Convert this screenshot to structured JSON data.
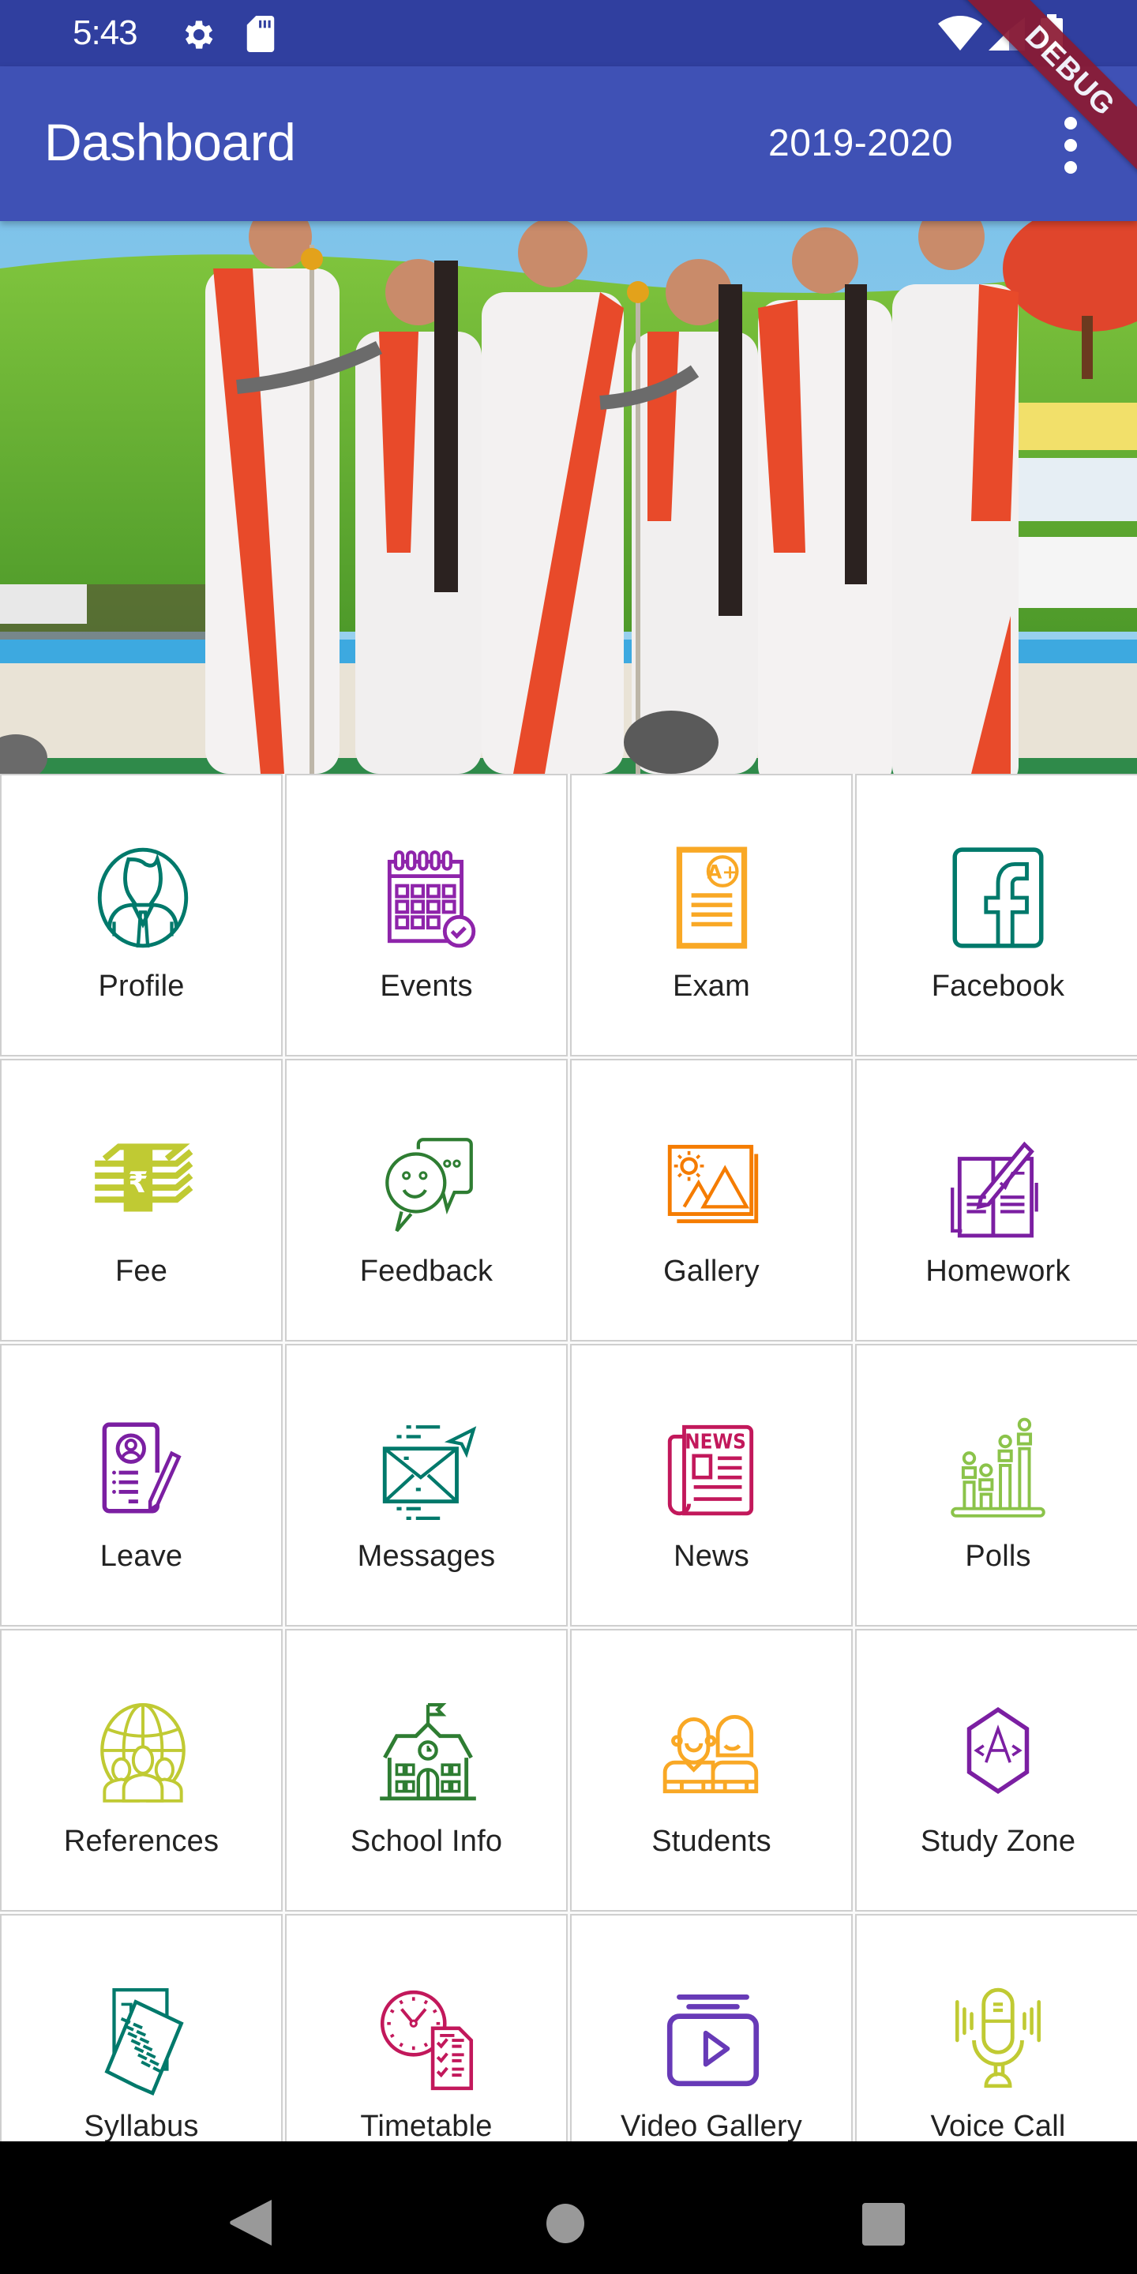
{
  "status_bar": {
    "time": "5:43",
    "left_icons": [
      "gear-icon",
      "sd-card-icon"
    ],
    "right_icons": [
      "wifi-icon",
      "signal-icon",
      "battery-icon"
    ]
  },
  "debug_banner": "DEBUG",
  "app_bar": {
    "title": "Dashboard",
    "session": "2019-2020",
    "menu_icon": "more-vert-icon"
  },
  "banner": {
    "description": "Students in white and red sarees singing at microphones on stage"
  },
  "tiles": [
    {
      "label": "Profile",
      "icon": "profile-icon",
      "color": "#00796b"
    },
    {
      "label": "Events",
      "icon": "calendar-icon",
      "color": "#8e24aa"
    },
    {
      "label": "Exam",
      "icon": "exam-sheet-icon",
      "color": "#f9a825"
    },
    {
      "label": "Facebook",
      "icon": "facebook-icon",
      "color": "#00796b"
    },
    {
      "label": "Fee",
      "icon": "rupee-stack-icon",
      "color": "#c0ca33"
    },
    {
      "label": "Feedback",
      "icon": "feedback-chat-icon",
      "color": "#2e7d32"
    },
    {
      "label": "Gallery",
      "icon": "gallery-icon",
      "color": "#f57c00"
    },
    {
      "label": "Homework",
      "icon": "homework-book-icon",
      "color": "#7b1fa2"
    },
    {
      "label": "Leave",
      "icon": "leave-form-icon",
      "color": "#7b1fa2"
    },
    {
      "label": "Messages",
      "icon": "envelope-send-icon",
      "color": "#00796b"
    },
    {
      "label": "News",
      "icon": "newspaper-icon",
      "color": "#c2185b"
    },
    {
      "label": "Polls",
      "icon": "poll-chart-icon",
      "color": "#8bc34a"
    },
    {
      "label": "References",
      "icon": "globe-people-icon",
      "color": "#c0ca33"
    },
    {
      "label": "School Info",
      "icon": "school-building-icon",
      "color": "#2e7d32"
    },
    {
      "label": "Students",
      "icon": "students-icon",
      "color": "#f9a825"
    },
    {
      "label": "Study Zone",
      "icon": "study-hexagon-icon",
      "color": "#7b1fa2"
    },
    {
      "label": "Syllabus",
      "icon": "syllabus-documents-icon",
      "color": "#00796b"
    },
    {
      "label": "Timetable",
      "icon": "timetable-clock-icon",
      "color": "#c2185b"
    },
    {
      "label": "Video Gallery",
      "icon": "video-play-icon",
      "color": "#673ab7"
    },
    {
      "label": "Voice Call",
      "icon": "microphone-icon",
      "color": "#c0ca33"
    }
  ],
  "nav_bar": {
    "buttons": [
      "back-icon",
      "home-icon",
      "recents-icon"
    ]
  }
}
